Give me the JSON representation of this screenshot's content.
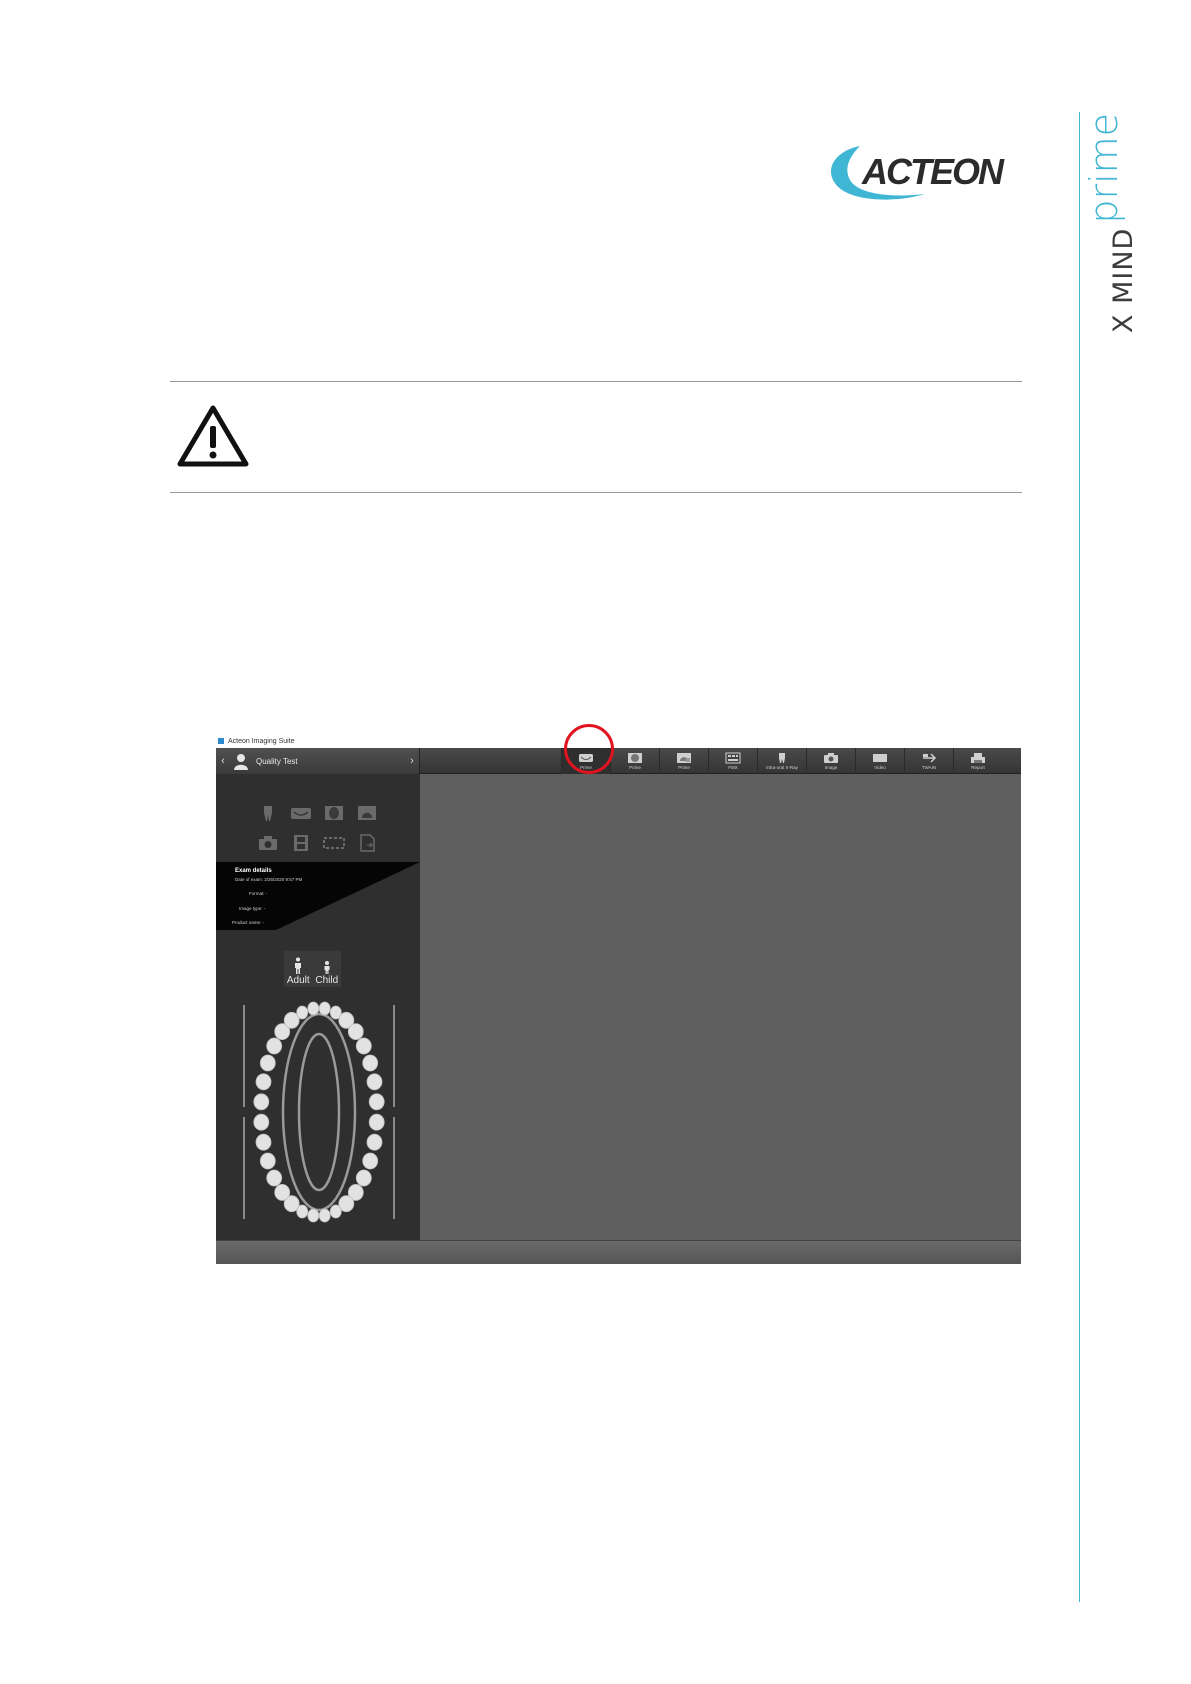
{
  "brand": {
    "logo_text": "ACTEON",
    "product_line_1": "X MIND",
    "product_line_2": "prime",
    "accent_color": "#3fb6d3",
    "logo_color": "#2b2b2b"
  },
  "warning": {
    "icon": "warning-triangle-icon"
  },
  "app": {
    "window_title": "Acteon Imaging Suite",
    "patient_name": "Quality Test",
    "toolbar_buttons": [
      {
        "label": "Prime",
        "icon": "panoramic-icon"
      },
      {
        "label": "Prime",
        "icon": "cephalometric-icon"
      },
      {
        "label": "Prime",
        "icon": "cbct-icon"
      },
      {
        "label": "FMX",
        "icon": "fmx-icon"
      },
      {
        "label": "Intra-oral X-Ray",
        "icon": "tooth-icon"
      },
      {
        "label": "Image",
        "icon": "camera-icon"
      },
      {
        "label": "Video",
        "icon": "video-icon"
      },
      {
        "label": "TWAIN",
        "icon": "twain-icon"
      },
      {
        "label": "Report",
        "icon": "printer-icon"
      }
    ],
    "exam_details": {
      "title": "Exam details",
      "date_of_exam": "Date of exam:  2/26/2020 9:57 PM",
      "format": "Format:  -",
      "image_type": "Image type:  -",
      "product_name": "Product name:  -"
    },
    "age": {
      "adult": "Adult",
      "child": "Child",
      "selected": "Adult"
    },
    "highlight_color": "#e0141e"
  }
}
